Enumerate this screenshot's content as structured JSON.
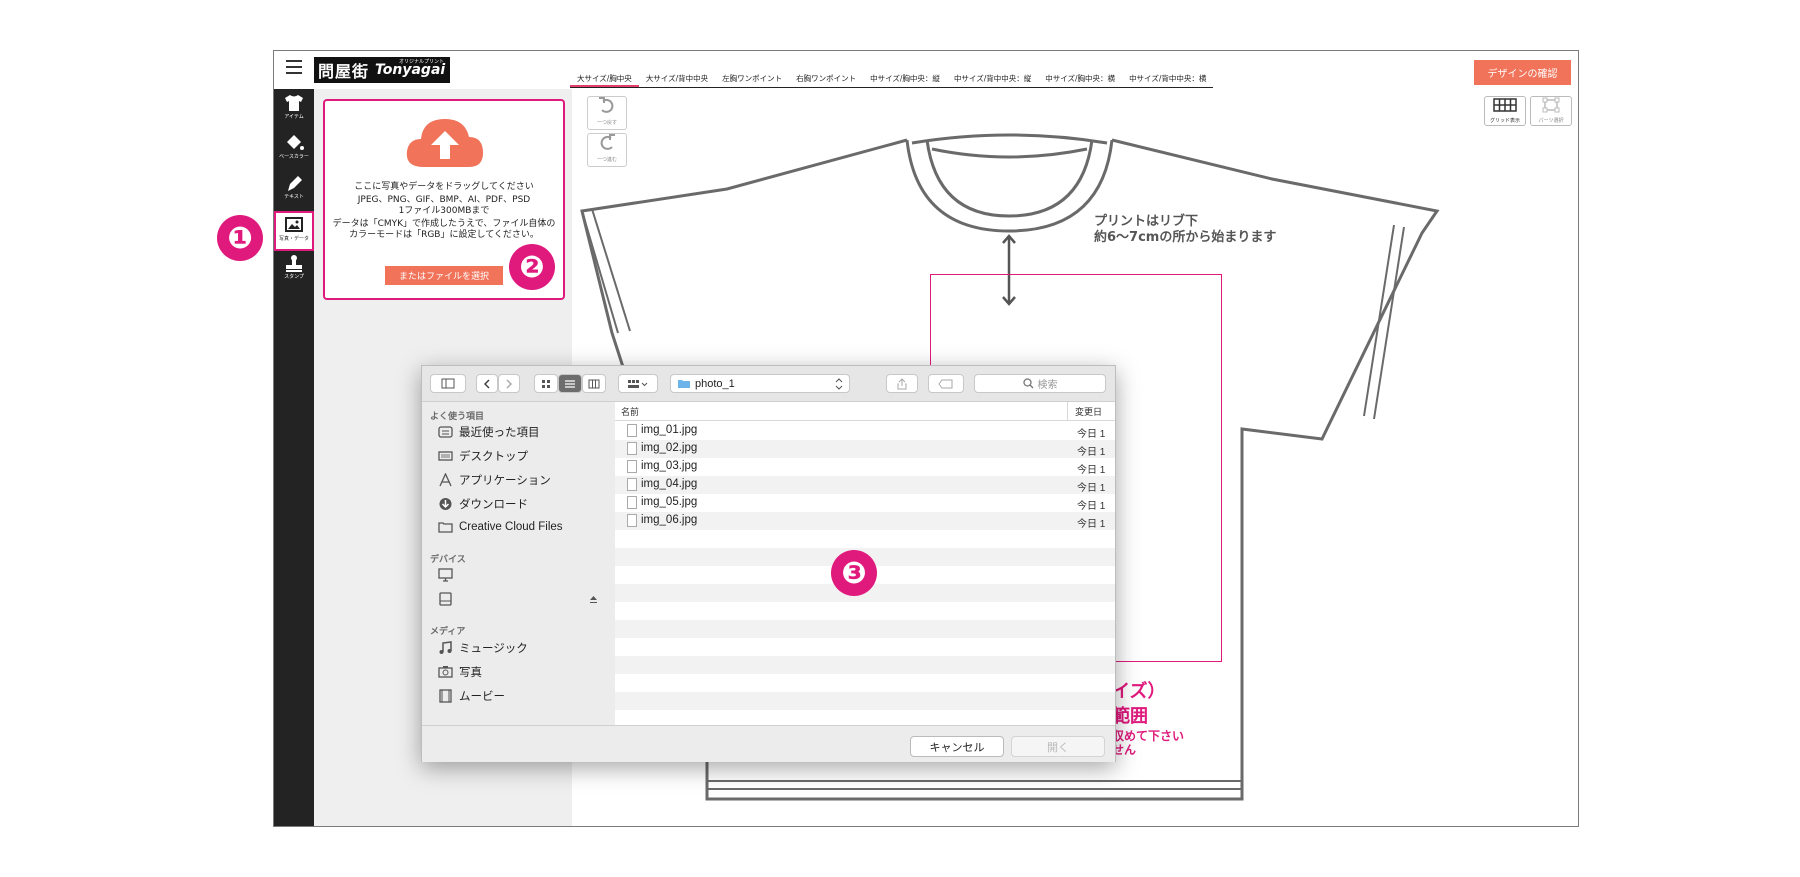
{
  "header": {
    "logo_text": "問屋街",
    "logo_en": "Tonyagai",
    "logo_small": "オリジナルプリント",
    "confirm_button": "デザインの確認"
  },
  "print_tabs": [
    "大サイズ/胸中央",
    "大サイズ/背中中央",
    "左胸ワンポイント",
    "右胸ワンポイント",
    "中サイズ/胸中央：縦",
    "中サイズ/背中中央：縦",
    "中サイズ/胸中央：横",
    "中サイズ/背中中央：横"
  ],
  "sidebar": {
    "items": [
      {
        "label": "アイテム",
        "icon": "tshirt-icon"
      },
      {
        "label": "ベースカラー",
        "icon": "paint-bucket-icon"
      },
      {
        "label": "テキスト",
        "icon": "pen-icon"
      },
      {
        "label": "写真・データ",
        "icon": "image-icon"
      },
      {
        "label": "スタンプ",
        "icon": "stamp-icon"
      }
    ]
  },
  "upload": {
    "drag_text": "ここに写真やデータをドラッグしてください",
    "formats": "JPEG、PNG、GIF、BMP、AI、PDF、PSD",
    "size_limit": "1ファイル300MBまで",
    "color_mode_note": "データは「CMYK」で作成したうえで、ファイル自体のカラーモードは「RGB」に設定してください。",
    "select_button": "またはファイルを選択"
  },
  "canvas": {
    "undo_label": "一つ戻す",
    "redo_label": "一つ進む",
    "grid_label": "グリッド表示",
    "parts_label": "パーツ選択",
    "rib_note_line1": "プリントはリブ下",
    "rib_note_line2": "約6〜7cmの所から始まります",
    "area_line1": "イズ）",
    "area_line2": "範囲",
    "note_line1": "収めて下さい",
    "note_line2": "せん"
  },
  "callouts": [
    "❶",
    "❷",
    "❸"
  ],
  "dialog": {
    "folder": "photo_1",
    "search_placeholder": "検索",
    "sections": {
      "favorites": "よく使う項目",
      "devices": "デバイス",
      "media": "メディア"
    },
    "favorites": [
      {
        "label": "最近使った項目",
        "icon": "recent-items-icon"
      },
      {
        "label": "デスクトップ",
        "icon": "desktop-icon"
      },
      {
        "label": "アプリケーション",
        "icon": "applications-icon"
      },
      {
        "label": "ダウンロード",
        "icon": "download-icon"
      },
      {
        "label": "Creative Cloud Files",
        "icon": "folder-icon"
      }
    ],
    "media": [
      {
        "label": "ミュージック",
        "icon": "music-icon"
      },
      {
        "label": "写真",
        "icon": "camera-icon"
      },
      {
        "label": "ムービー",
        "icon": "film-icon"
      }
    ],
    "columns": {
      "name": "名前",
      "modified": "変更日"
    },
    "files": [
      {
        "name": "img_01.jpg",
        "date": "今日 1"
      },
      {
        "name": "img_02.jpg",
        "date": "今日 1"
      },
      {
        "name": "img_03.jpg",
        "date": "今日 1"
      },
      {
        "name": "img_04.jpg",
        "date": "今日 1"
      },
      {
        "name": "img_05.jpg",
        "date": "今日 1"
      },
      {
        "name": "img_06.jpg",
        "date": "今日 1"
      }
    ],
    "cancel_button": "キャンセル",
    "open_button": "開く"
  },
  "colors": {
    "accent": "#f0735a",
    "highlight": "#e0197d",
    "sidebar": "#232323"
  }
}
